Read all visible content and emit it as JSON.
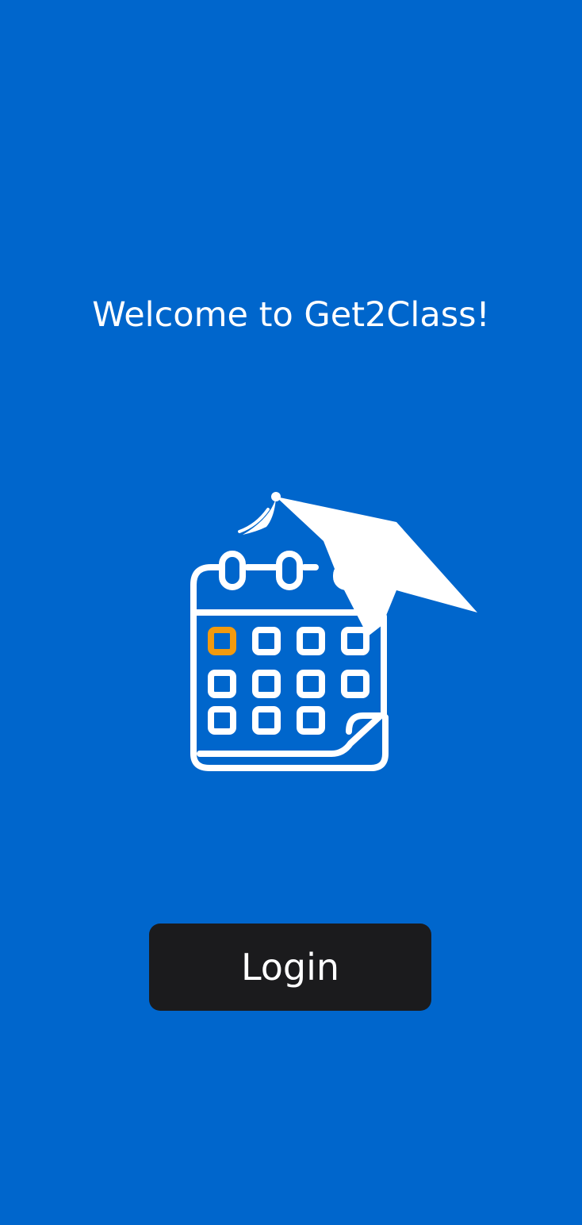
{
  "app": {
    "welcome_text": "Welcome to Get2Class!"
  },
  "logo": {
    "icon": "calendar-graduation-cap-icon",
    "highlight_color": "#f29a0e",
    "stroke_color": "#ffffff"
  },
  "login": {
    "label": "Login"
  },
  "colors": {
    "background": "#0066cc",
    "button": "#1b1b1d",
    "text": "#ffffff"
  }
}
